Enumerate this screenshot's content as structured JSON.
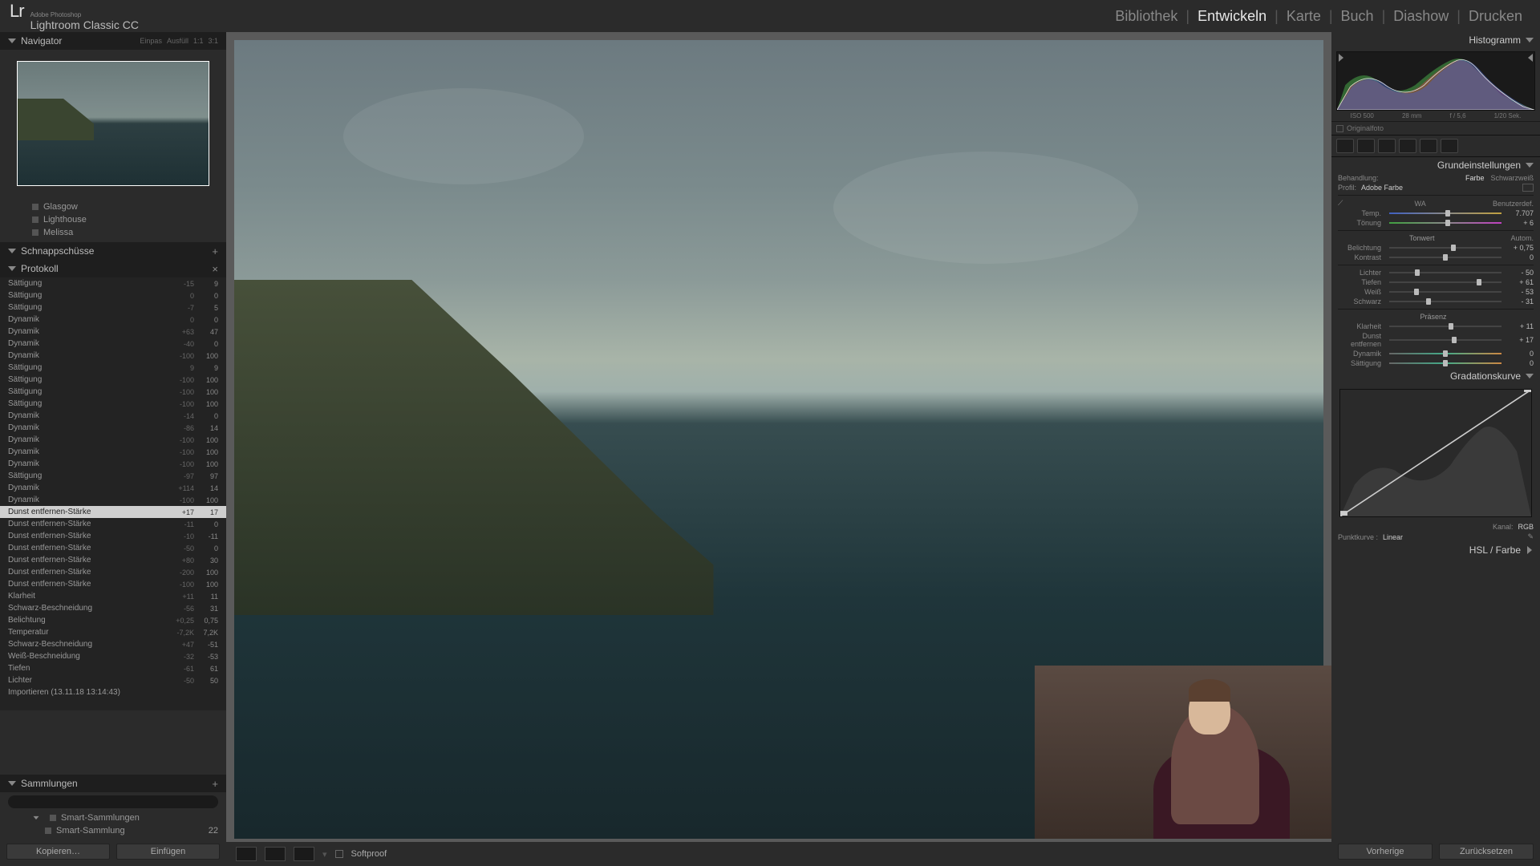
{
  "app": {
    "brand_small": "Adobe Photoshop",
    "brand": "Lightroom Classic CC",
    "logo_text": "Lr"
  },
  "modules": {
    "items": [
      "Bibliothek",
      "Entwickeln",
      "Karte",
      "Buch",
      "Diashow",
      "Drucken"
    ],
    "active_index": 1
  },
  "left": {
    "navigator": {
      "title": "Navigator",
      "fit": "Einpas",
      "extra1": "Ausfüll",
      "extra2": "1:1",
      "extra3": "3:1"
    },
    "folders": {
      "items": [
        "Glasgow",
        "Lighthouse",
        "Melissa"
      ]
    },
    "snapshots": {
      "title": "Schnappschüsse"
    },
    "history": {
      "title": "Protokoll",
      "rows": [
        {
          "l": "Sättigung",
          "a": "-15",
          "b": "9"
        },
        {
          "l": "Sättigung",
          "a": "0",
          "b": "0"
        },
        {
          "l": "Sättigung",
          "a": "-7",
          "b": "5"
        },
        {
          "l": "Dynamik",
          "a": "0",
          "b": "0"
        },
        {
          "l": "Dynamik",
          "a": "+63",
          "b": "47"
        },
        {
          "l": "Dynamik",
          "a": "-40",
          "b": "0"
        },
        {
          "l": "Dynamik",
          "a": "-100",
          "b": "100"
        },
        {
          "l": "Sättigung",
          "a": "9",
          "b": "9"
        },
        {
          "l": "Sättigung",
          "a": "-100",
          "b": "100"
        },
        {
          "l": "Sättigung",
          "a": "-100",
          "b": "100"
        },
        {
          "l": "Sättigung",
          "a": "-100",
          "b": "100"
        },
        {
          "l": "Dynamik",
          "a": "-14",
          "b": "0"
        },
        {
          "l": "Dynamik",
          "a": "-86",
          "b": "14"
        },
        {
          "l": "Dynamik",
          "a": "-100",
          "b": "100"
        },
        {
          "l": "Dynamik",
          "a": "-100",
          "b": "100"
        },
        {
          "l": "Dynamik",
          "a": "-100",
          "b": "100"
        },
        {
          "l": "Sättigung",
          "a": "-97",
          "b": "97"
        },
        {
          "l": "Dynamik",
          "a": "+114",
          "b": "14"
        },
        {
          "l": "Dynamik",
          "a": "-100",
          "b": "100"
        },
        {
          "l": "Dunst entfernen-Stärke",
          "a": "+17",
          "b": "17",
          "sel": true
        },
        {
          "l": "Dunst entfernen-Stärke",
          "a": "-11",
          "b": "0"
        },
        {
          "l": "Dunst entfernen-Stärke",
          "a": "-10",
          "b": "-11"
        },
        {
          "l": "Dunst entfernen-Stärke",
          "a": "-50",
          "b": "0"
        },
        {
          "l": "Dunst entfernen-Stärke",
          "a": "+80",
          "b": "30"
        },
        {
          "l": "Dunst entfernen-Stärke",
          "a": "-200",
          "b": "100"
        },
        {
          "l": "Dunst entfernen-Stärke",
          "a": "-100",
          "b": "100"
        },
        {
          "l": "Klarheit",
          "a": "+11",
          "b": "11"
        },
        {
          "l": "Schwarz-Beschneidung",
          "a": "-56",
          "b": "31"
        },
        {
          "l": "Belichtung",
          "a": "+0,25",
          "b": "0,75"
        },
        {
          "l": "Temperatur",
          "a": "-7,2K",
          "b": "7,2K"
        },
        {
          "l": "Schwarz-Beschneidung",
          "a": "+47",
          "b": "-51"
        },
        {
          "l": "Weiß-Beschneidung",
          "a": "-32",
          "b": "-53"
        },
        {
          "l": "Tiefen",
          "a": "-61",
          "b": "61"
        },
        {
          "l": "Lichter",
          "a": "-50",
          "b": "50"
        },
        {
          "l": "Importieren (13.11.18 13:14:43)",
          "a": "",
          "b": ""
        }
      ]
    },
    "collections": {
      "title": "Sammlungen",
      "smart": "Smart-Sammlungen",
      "smart_item": "Smart-Sammlung",
      "smart_count": "22"
    },
    "buttons": {
      "copy": "Kopieren…",
      "paste": "Einfügen"
    }
  },
  "center": {
    "softproof": "Softproof"
  },
  "right": {
    "histogram": {
      "title": "Histogramm",
      "iso": "ISO 500",
      "focal": "28 mm",
      "aperture": "f / 5,6",
      "shutter": "1/20 Sek.",
      "original": "Originalfoto"
    },
    "basic": {
      "title": "Grundeinstellungen",
      "treatment": "Behandlung:",
      "color": "Farbe",
      "bw": "Schwarzweiß",
      "profile_label": "Profil:",
      "profile": "Adobe Farbe",
      "wb_label": "WA",
      "wb_value": "Benutzerdef.",
      "temp_label": "Temp.",
      "temp_value": "7.707",
      "tint_label": "Tönung",
      "tint_value": "+ 6",
      "tone_header": "Tonwert",
      "auto": "Autom.",
      "exposure_label": "Belichtung",
      "exposure_value": "+ 0,75",
      "contrast_label": "Kontrast",
      "contrast_value": "0",
      "highlights_label": "Lichter",
      "highlights_value": "- 50",
      "shadows_label": "Tiefen",
      "shadows_value": "+ 61",
      "whites_label": "Weiß",
      "whites_value": "- 53",
      "blacks_label": "Schwarz",
      "blacks_value": "- 31",
      "presence_header": "Präsenz",
      "clarity_label": "Klarheit",
      "clarity_value": "+ 11",
      "dehaze_label": "Dunst entfernen",
      "dehaze_value": "+ 17",
      "vibrance_label": "Dynamik",
      "vibrance_value": "0",
      "saturation_label": "Sättigung",
      "saturation_value": "0"
    },
    "curve": {
      "title": "Gradationskurve",
      "channel_label": "Kanal:",
      "channel": "RGB",
      "point_label": "Punktkurve :",
      "point": "Linear"
    },
    "hsl": {
      "title": "HSL / Farbe"
    },
    "buttons": {
      "prev": "Vorherige",
      "reset": "Zurücksetzen"
    }
  }
}
